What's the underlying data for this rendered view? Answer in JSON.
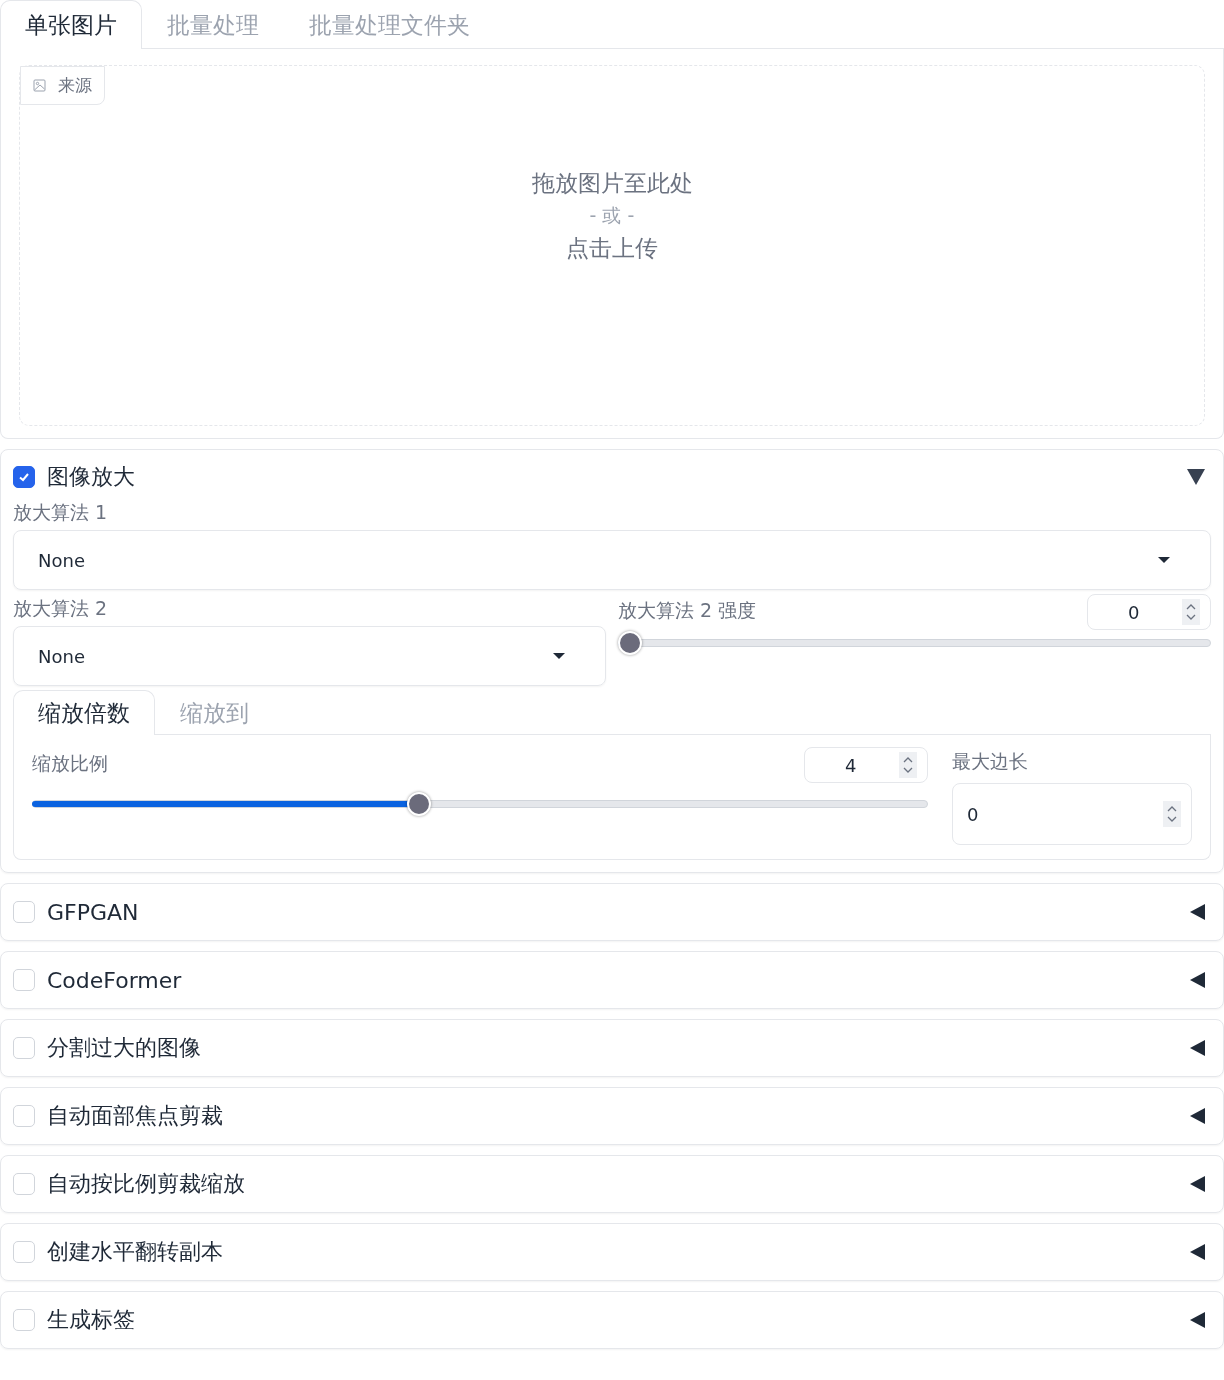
{
  "tabs": [
    {
      "label": "单张图片",
      "selected": true
    },
    {
      "label": "批量处理",
      "selected": false
    },
    {
      "label": "批量处理文件夹",
      "selected": false
    }
  ],
  "image_input": {
    "label": "来源",
    "drop_text": "拖放图片至此处",
    "or_text": "- 或 -",
    "click_text": "点击上传"
  },
  "upscale": {
    "title": "图像放大",
    "checked": true,
    "expanded": true,
    "upscaler_1": {
      "label": "放大算法 1",
      "value": "None"
    },
    "upscaler_2": {
      "label": "放大算法 2",
      "value": "None"
    },
    "upscaler_2_strength": {
      "label": "放大算法 2 强度",
      "value": "0",
      "level": 0
    },
    "resize_tabs": [
      {
        "label": "缩放倍数",
        "selected": true
      },
      {
        "label": "缩放到",
        "selected": false
      }
    ],
    "scale": {
      "label": "缩放比例",
      "value": "4",
      "level": 0.43
    },
    "max_side": {
      "label": "最大边长",
      "value": "0"
    }
  },
  "sections": [
    {
      "title": "GFPGAN",
      "checked": false,
      "expanded": false
    },
    {
      "title": "CodeFormer",
      "checked": false,
      "expanded": false
    },
    {
      "title": "分割过大的图像",
      "checked": false,
      "expanded": false
    },
    {
      "title": "自动面部焦点剪裁",
      "checked": false,
      "expanded": false
    },
    {
      "title": "自动按比例剪裁缩放",
      "checked": false,
      "expanded": false
    },
    {
      "title": "创建水平翻转副本",
      "checked": false,
      "expanded": false
    },
    {
      "title": "生成标签",
      "checked": false,
      "expanded": false
    }
  ]
}
